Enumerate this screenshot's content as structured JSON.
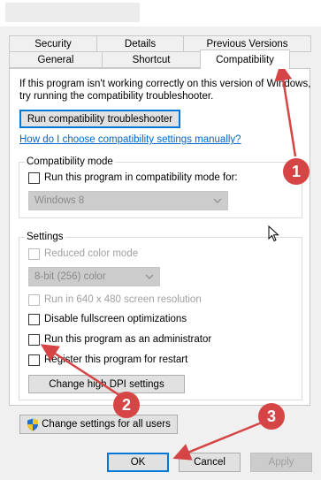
{
  "tabs": {
    "row1": [
      "Security",
      "Details",
      "Previous Versions"
    ],
    "row2": [
      "General",
      "Shortcut",
      "Compatibility"
    ]
  },
  "intro": {
    "line1": "If this program isn't working correctly on this version of Windows,",
    "line2": "try running the compatibility troubleshooter."
  },
  "troubleshooter_button": "Run compatibility troubleshooter",
  "help_link": "How do I choose compatibility settings manually?",
  "compat_mode": {
    "group_label": "Compatibility mode",
    "checkbox_label": "Run this program in compatibility mode for:",
    "os_select_value": "Windows 8"
  },
  "settings": {
    "group_label": "Settings",
    "reduced_color": "Reduced color mode",
    "color_select_value": "8-bit (256) color",
    "run_640": "Run in 640 x 480 screen resolution",
    "disable_fullscreen": "Disable fullscreen optimizations",
    "run_as_admin": "Run this program as an administrator",
    "register_restart": "Register this program for restart",
    "dpi_button": "Change high DPI settings"
  },
  "all_users_button": "Change settings for all users",
  "footer": {
    "ok": "OK",
    "cancel": "Cancel",
    "apply": "Apply"
  },
  "annotations": [
    "1",
    "2",
    "3"
  ],
  "colors": {
    "annotation": "#d64545",
    "link": "#0066cc",
    "focus": "#0078d7"
  }
}
